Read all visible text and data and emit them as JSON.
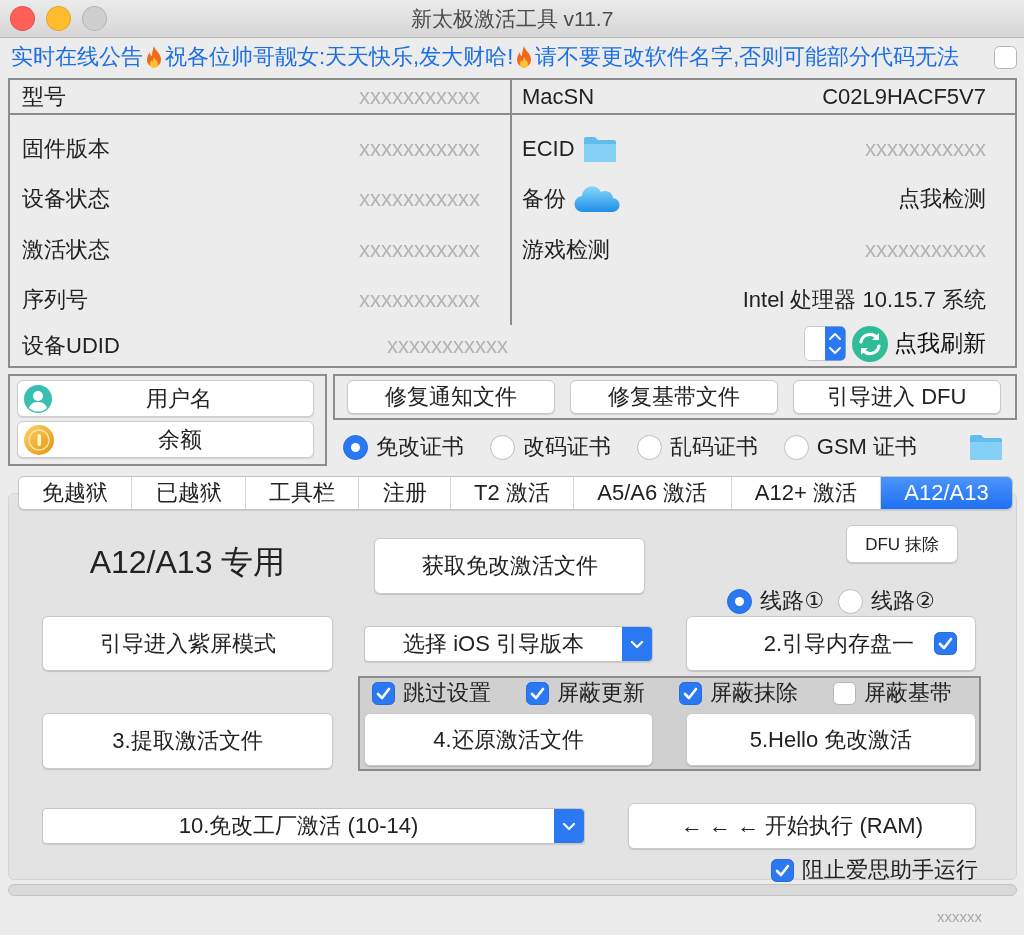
{
  "window": {
    "title": "新太极激活工具 v11.7",
    "traffic_lights": [
      {
        "kind": "close",
        "disabled": false
      },
      {
        "kind": "minimize",
        "disabled": false
      },
      {
        "kind": "zoom",
        "disabled": true
      }
    ]
  },
  "marquee": {
    "segments": [
      {
        "kind": "text",
        "text": "实时在线公告"
      },
      {
        "kind": "fire"
      },
      {
        "kind": "text",
        "text": "祝各位帅哥靓女:天天快乐,发大财哈!"
      },
      {
        "kind": "fire"
      },
      {
        "kind": "text",
        "text": "请不要更改软件名字,否则可能部分代码无法"
      }
    ],
    "checkbox": {
      "checked": false
    }
  },
  "device_info": {
    "left": [
      {
        "label": "型号",
        "value": "xxxxxxxxxxx",
        "greyed": true
      },
      {
        "label": "固件版本",
        "value": "xxxxxxxxxxx",
        "greyed": true
      },
      {
        "label": "设备状态",
        "value": "xxxxxxxxxxx",
        "greyed": true
      },
      {
        "label": "激活状态",
        "value": "xxxxxxxxxxx",
        "greyed": true
      },
      {
        "label": "序列号",
        "value": "xxxxxxxxxxx",
        "greyed": true
      },
      {
        "label": "设备UDID",
        "value": "xxxxxxxxxxx",
        "greyed": true
      }
    ],
    "right": [
      {
        "label": "MacSN",
        "value": "C02L9HACF5V7",
        "greyed": false
      },
      {
        "label": "ECID",
        "value": "xxxxxxxxxxx",
        "greyed": true
      },
      {
        "label": "备份",
        "value": "点我检测",
        "greyed": false
      },
      {
        "label": "游戏检测",
        "value": "xxxxxxxxxxx",
        "greyed": true
      },
      {
        "value": "Intel 处理器 10.15.7 系统",
        "greyed": false
      }
    ],
    "refresh": {
      "label": "点我刷新"
    }
  },
  "account": [
    {
      "kind": "user",
      "label": "用户名"
    },
    {
      "kind": "coin",
      "label": "余额"
    }
  ],
  "repair_buttons": [
    "修复通知文件",
    "修复基带文件",
    "引导进入 DFU"
  ],
  "certificate_options": [
    {
      "label": "免改证书",
      "selected": true
    },
    {
      "label": "改码证书",
      "selected": false
    },
    {
      "label": "乱码证书",
      "selected": false
    },
    {
      "label": "GSM 证书",
      "selected": false
    }
  ],
  "tabs": [
    {
      "label": "免越狱",
      "selected": false
    },
    {
      "label": "已越狱",
      "selected": false
    },
    {
      "label": "工具栏",
      "selected": false
    },
    {
      "label": "注册",
      "selected": false
    },
    {
      "label": "T2 激活",
      "selected": false
    },
    {
      "label": "A5/A6 激活",
      "selected": false
    },
    {
      "label": "A12+ 激活",
      "selected": false
    },
    {
      "label": "A12/A13",
      "selected": true
    }
  ],
  "panel": {
    "title": "A12/A13 专用",
    "get_file_button": "获取免改激活文件",
    "dfu_erase_button": "DFU 抹除",
    "route_options": [
      {
        "label": "线路①",
        "selected": true
      },
      {
        "label": "线路②",
        "selected": false
      }
    ],
    "screen_mode_button": "引导进入紫屏模式",
    "ios_version_select": {
      "value": "选择 iOS 引导版本"
    },
    "ramdisk_button": {
      "label": "2.引导内存盘一",
      "checked": true
    },
    "extract_button": "3.提取激活文件",
    "options": [
      {
        "label": "跳过设置",
        "checked": true
      },
      {
        "label": "屏蔽更新",
        "checked": true
      },
      {
        "label": "屏蔽抹除",
        "checked": true
      },
      {
        "label": "屏蔽基带",
        "checked": false
      }
    ],
    "restore_button": "4.还原激活文件",
    "hello_button": "5.Hello 免改激活",
    "mode_select": {
      "value": "10.免改工厂激活 (10-14)"
    },
    "start_button": "← ← ← 开始执行 (RAM)",
    "block_option": {
      "label": "阻止爱思助手运行",
      "checked": true
    }
  },
  "status": "xxxxxx"
}
